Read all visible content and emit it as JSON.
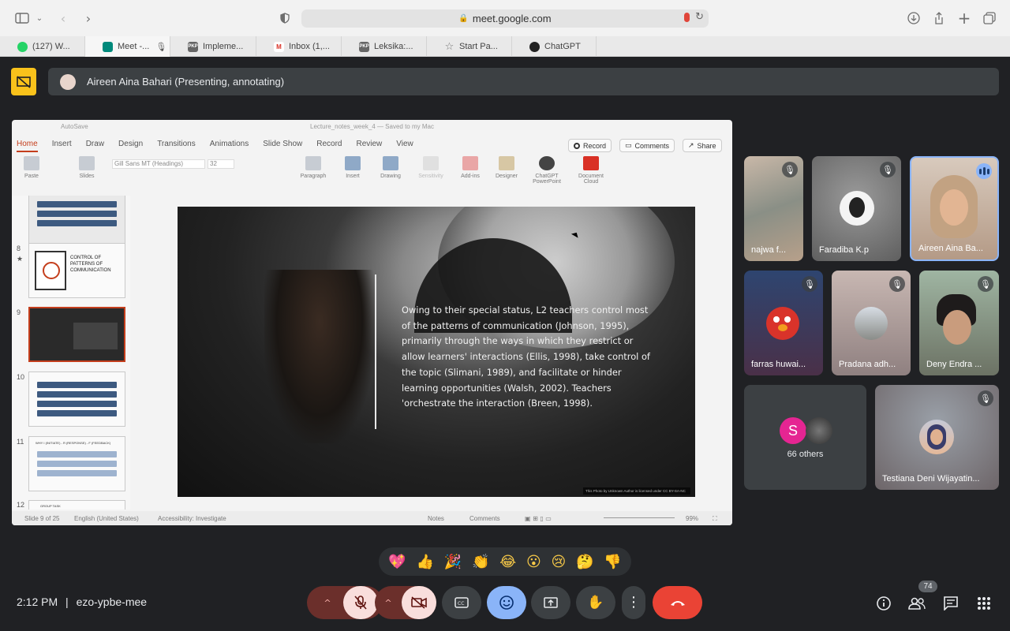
{
  "browser": {
    "url": "meet.google.com",
    "tabs": [
      {
        "label": "(127) W...",
        "color": "#25d366",
        "glyph": "W"
      },
      {
        "label": "Meet -...",
        "color": "#00897b",
        "glyph": "M"
      },
      {
        "label": "Impleme...",
        "color": "#555555",
        "glyph": "PKP"
      },
      {
        "label": "Inbox (1,...",
        "color": "#d93025",
        "glyph": "M"
      },
      {
        "label": "Leksika:...",
        "color": "#555555",
        "glyph": "PKP"
      },
      {
        "label": "Start Pa...",
        "color": "#888888",
        "glyph": "☆"
      },
      {
        "label": "ChatGPT",
        "color": "#222222",
        "glyph": "◎"
      }
    ]
  },
  "presenter": {
    "label": "Aireen Aina Bahari (Presenting, annotating)"
  },
  "ppt": {
    "autosave": "AutoSave",
    "doc_title": "Lecture_notes_week_4 — Saved to my Mac",
    "menu": [
      "Home",
      "Insert",
      "Draw",
      "Design",
      "Transitions",
      "Animations",
      "Slide Show",
      "Record",
      "Review",
      "View"
    ],
    "record_label": "Record",
    "comments_label": "Comments",
    "share_label": "Share",
    "font_name": "Gill Sans MT (Headings)",
    "font_size": "32",
    "ribbon": [
      "Paste",
      "Slides",
      "Paragraph",
      "Insert",
      "Drawing",
      "Sensitivity",
      "Add-ins",
      "Designer",
      "ChatGPT PowerPoint",
      "Document Cloud"
    ],
    "thumb_numbers": [
      "8",
      "9",
      "10",
      "11",
      "12"
    ],
    "thumb8_text": "CONTROL OF PATTERNS OF COMMUNICATION",
    "thumb11_text": "WHY I (INITIATE) - R (RESPONSE) - F (FEEDBACK)",
    "thumb12_text": "GROUP TASK",
    "slide_quote": "Owing to their special status, L2 teachers control most of the patterns of communication (Johnson, 1995), primarily through the ways in which they restrict or allow learners' interactions (Ellis, 1998), take control of the topic (Slimani, 1989), and facilitate or hinder learning opportunities (Walsh, 2002). Teachers 'orchestrate the interaction (Breen, 1998).",
    "slide_credit": "This Photo by Unknown Author is licensed under CC BY-SA-NC",
    "status_slide": "Slide 9 of 25",
    "status_lang": "English (United States)",
    "status_access": "Accessibility: Investigate",
    "status_notes": "Notes",
    "status_comments": "Comments",
    "zoom": "99%"
  },
  "participants": {
    "najwa": "najwa f...",
    "faradiba": "Faradiba K.p",
    "aireen": "Aireen Aina Ba...",
    "farras": "farras huwai...",
    "pradana": "Pradana adh...",
    "deny": "Deny Endra ...",
    "others_initial": "S",
    "others_label": "66 others",
    "testiana": "Testiana Deni Wijayatin..."
  },
  "reactions": [
    "💖",
    "👍",
    "🎉",
    "👏",
    "😂",
    "😮",
    "😢",
    "🤔",
    "👎"
  ],
  "meeting": {
    "time": "2:12 PM",
    "separator": "|",
    "code": "ezo-ypbe-mee",
    "participant_count": "74"
  },
  "colors": {
    "meet_bg": "#202124",
    "end_call": "#ea4335",
    "present_flag": "#f9c21b",
    "ppt_accent": "#c43e1c"
  }
}
